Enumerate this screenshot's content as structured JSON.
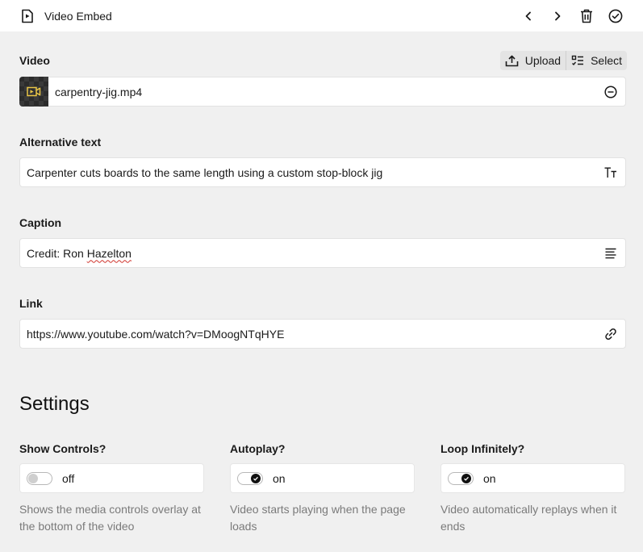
{
  "header": {
    "title": "Video Embed",
    "icons": [
      "video-file-icon",
      "chevron-left-icon",
      "chevron-right-icon",
      "trash-icon",
      "check-circle-icon"
    ]
  },
  "video": {
    "label": "Video",
    "upload_label": "Upload",
    "select_label": "Select",
    "filename": "carpentry-jig.mp4",
    "thumb_accent": "#e8c547"
  },
  "alt_text": {
    "label": "Alternative text",
    "value": "Carpenter cuts boards to the same length using a custom stop-block jig"
  },
  "caption": {
    "label": "Caption",
    "value_prefix": "Credit: Ron ",
    "value_misspelled": "Hazelton"
  },
  "link": {
    "label": "Link",
    "value": "https://www.youtube.com/watch?v=DMoogNTqHYE"
  },
  "settings": {
    "heading": "Settings",
    "items": [
      {
        "label": "Show Controls?",
        "state": "off",
        "enabled": false,
        "description": "Shows the media controls overlay at the bottom of the video"
      },
      {
        "label": "Autoplay?",
        "state": "on",
        "enabled": true,
        "description": "Video starts playing when the page loads"
      },
      {
        "label": "Loop Infinitely?",
        "state": "on",
        "enabled": true,
        "description": "Video automatically replays when it ends"
      }
    ]
  }
}
